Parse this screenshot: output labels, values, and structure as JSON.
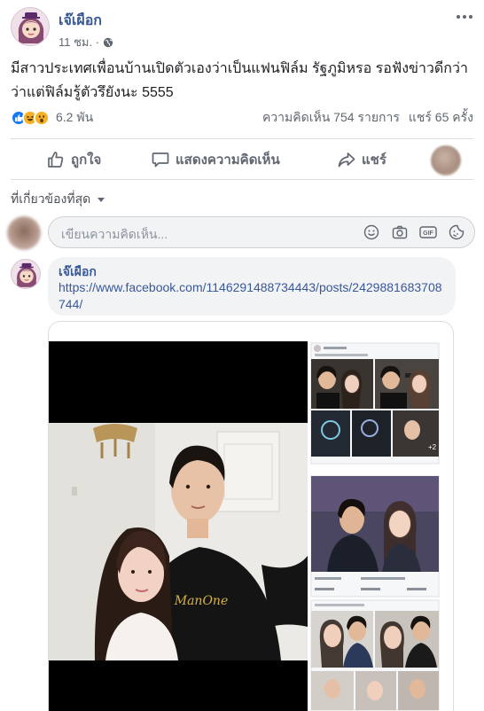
{
  "post": {
    "author": "เจ๊เผือก",
    "time": "11 ชม. ·",
    "text": "มีสาวประเทศเพื่อนบ้านเปิดตัวเองว่าเป็นแฟนฟิล์ม รัฐภูมิหรอ รอฟังข่าวดีกว่า ว่าแต่ฟิล์มรู้ตัวรึยังนะ 5555",
    "reactions": {
      "icons": [
        "like",
        "haha",
        "wow"
      ],
      "count": "6.2 พัน"
    },
    "comments_count": "ความคิดเห็น 754 รายการ",
    "shares_count": "แชร์ 65 ครั้ง"
  },
  "actions": {
    "like": "ถูกใจ",
    "comment": "แสดงความคิดเห็น",
    "share": "แชร์"
  },
  "comments_section": {
    "sort_label": "ที่เกี่ยวข้องที่สุด",
    "composer_placeholder": "เขียนความคิดเห็น...",
    "composer_icons": [
      "emoji-icon",
      "camera-icon",
      "gif-icon",
      "sticker-icon"
    ]
  },
  "comment": {
    "author": "เจ๊เผือก",
    "link": "https://www.facebook.com/1146291488734443/posts/2429881683708744/"
  },
  "colors": {
    "link_blue": "#385898",
    "like_blue": "#1877f2",
    "text_gray": "#606770",
    "bubble_bg": "#f2f3f5"
  }
}
